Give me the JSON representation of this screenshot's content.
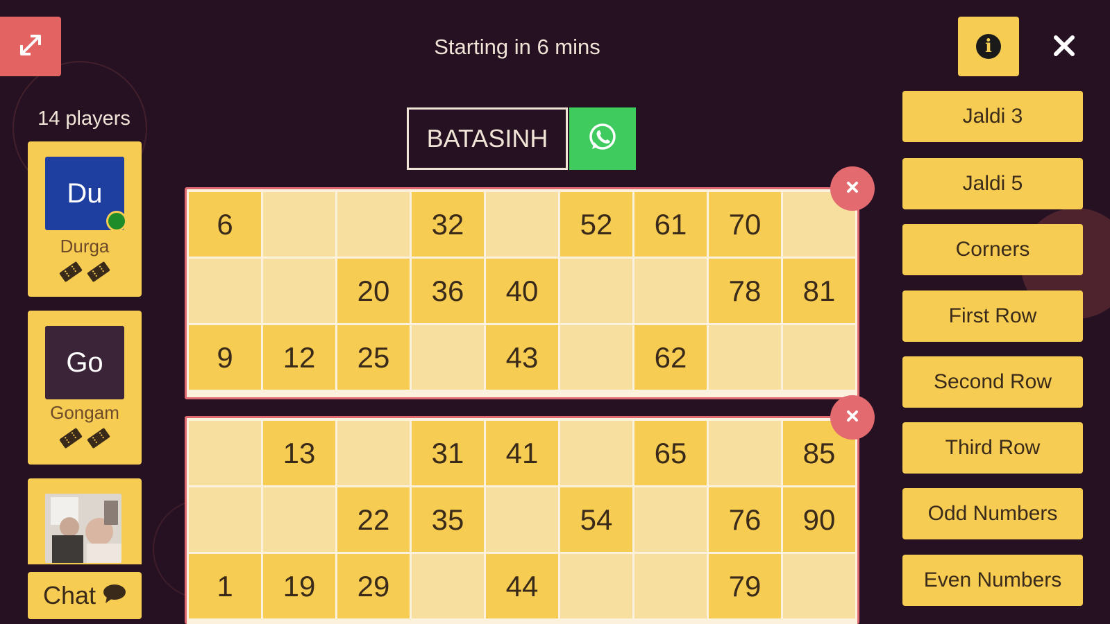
{
  "header": {
    "status": "Starting in 6 mins",
    "expand_icon": "expand-icon",
    "info_icon": "info-icon",
    "close_icon": "close-icon"
  },
  "room": {
    "code": "BATASINH",
    "share_icon": "whatsapp-icon"
  },
  "players": {
    "count_label": "14 players",
    "list": [
      {
        "initials": "Du",
        "name": "Durga",
        "avatar_color": "#1e3fa0",
        "online": true,
        "tickets": 2
      },
      {
        "initials": "Go",
        "name": "Gongam",
        "avatar_color": "#3b2338",
        "online": false,
        "tickets": 2
      },
      {
        "initials": "",
        "name": "",
        "photo": true
      }
    ]
  },
  "chat": {
    "label": "Chat",
    "icon": "speech-bubble-icon"
  },
  "tickets": [
    {
      "rows": [
        [
          "6",
          "",
          "",
          "32",
          "",
          "52",
          "61",
          "70",
          ""
        ],
        [
          "",
          "",
          "20",
          "36",
          "40",
          "",
          "",
          "78",
          "81"
        ],
        [
          "9",
          "12",
          "25",
          "",
          "43",
          "",
          "62",
          "",
          ""
        ]
      ]
    },
    {
      "rows": [
        [
          "",
          "13",
          "",
          "31",
          "41",
          "",
          "65",
          "",
          "85"
        ],
        [
          "",
          "",
          "22",
          "35",
          "",
          "54",
          "",
          "76",
          "90"
        ],
        [
          "1",
          "19",
          "29",
          "",
          "44",
          "",
          "",
          "79",
          ""
        ]
      ]
    }
  ],
  "prizes": [
    "Jaldi 3",
    "Jaldi 5",
    "Corners",
    "First Row",
    "Second Row",
    "Third Row",
    "Odd Numbers",
    "Even Numbers"
  ],
  "colors": {
    "background": "#261123",
    "accent_yellow": "#f6cc52",
    "blank_cell": "#f7df9f",
    "danger_red": "#e36363",
    "whatsapp_green": "#3fcb5e"
  }
}
